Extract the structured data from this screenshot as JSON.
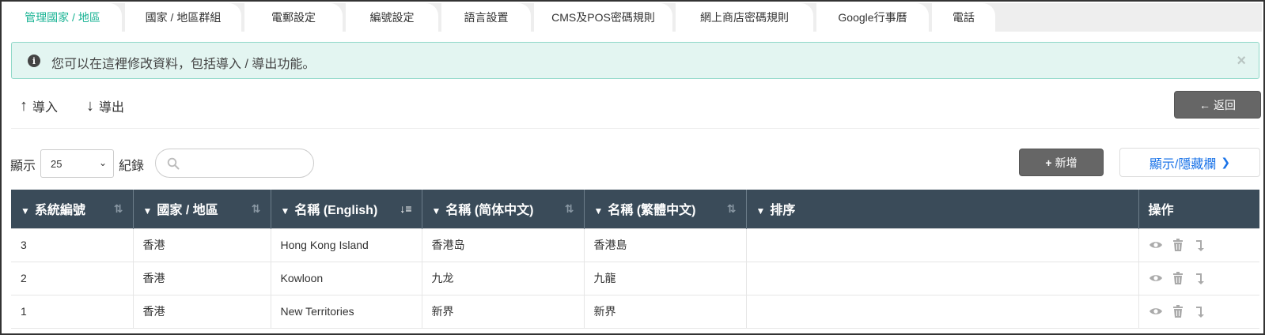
{
  "tabs": [
    {
      "label": "管理國家 / 地區",
      "active": true
    },
    {
      "label": "國家 / 地區群組",
      "active": false
    },
    {
      "label": "電郵設定",
      "active": false
    },
    {
      "label": "編號設定",
      "active": false
    },
    {
      "label": "語言設置",
      "active": false
    },
    {
      "label": "CMS及POS密碼規則",
      "active": false
    },
    {
      "label": "網上商店密碼規則",
      "active": false
    },
    {
      "label": "Google行事曆",
      "active": false
    },
    {
      "label": "電話",
      "active": false
    }
  ],
  "alert": {
    "icon": "info-circle-icon",
    "text": "您可以在這裡修改資料，包括導入 / 導出功能。",
    "close": "×"
  },
  "toolbar": {
    "import_label": "導入",
    "export_label": "導出",
    "back_label": "返回"
  },
  "controls": {
    "show_label": "顯示",
    "page_size": "25",
    "records_label": "紀錄",
    "search_placeholder": "",
    "add_label": "新增",
    "toggle_columns_label": "顯示/隱藏欄"
  },
  "table": {
    "columns": [
      {
        "label": "系統編號",
        "sortable": true,
        "sorted": false
      },
      {
        "label": "國家 / 地區",
        "sortable": true,
        "sorted": false
      },
      {
        "label": "名稱 (English)",
        "sortable": true,
        "sorted": true
      },
      {
        "label": "名稱 (简体中文)",
        "sortable": true,
        "sorted": false
      },
      {
        "label": "名稱 (繁體中文)",
        "sortable": true,
        "sorted": false
      },
      {
        "label": "排序",
        "sortable": false,
        "sorted": false
      },
      {
        "label": "操作",
        "sortable": false,
        "sorted": false
      }
    ],
    "rows": [
      {
        "id": "3",
        "region": "香港",
        "name_en": "Hong Kong Island",
        "name_sc": "香港岛",
        "name_tc": "香港島",
        "order": ""
      },
      {
        "id": "2",
        "region": "香港",
        "name_en": "Kowloon",
        "name_sc": "九龙",
        "name_tc": "九龍",
        "order": ""
      },
      {
        "id": "1",
        "region": "香港",
        "name_en": "New Territories",
        "name_sc": "新界",
        "name_tc": "新界",
        "order": ""
      }
    ]
  },
  "colors": {
    "active_tab": "#1ab394",
    "header_bg": "#3a4b59",
    "button_bg": "#666666",
    "link_blue": "#1a73e8",
    "alert_bg": "#e3f5f1"
  }
}
